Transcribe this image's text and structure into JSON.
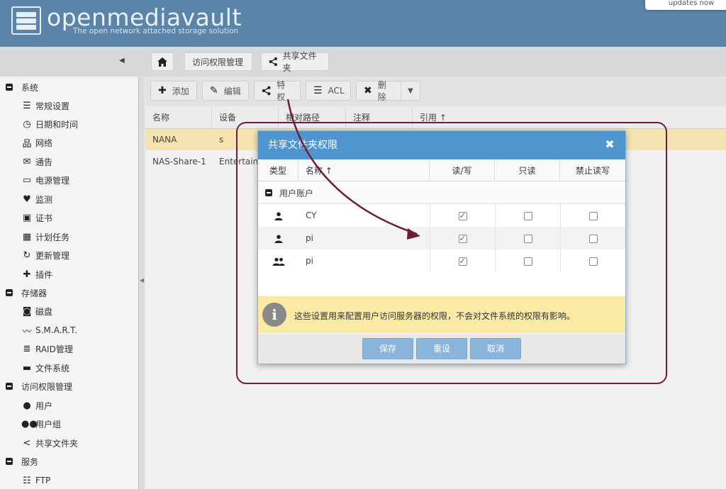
{
  "header": {
    "brand": "openmediavault",
    "tagline": "The open network attached storage solution",
    "updates_label": "updates now"
  },
  "breadcrumb": {
    "items": [
      "访问权限管理",
      "共享文件夹"
    ]
  },
  "sidebar": {
    "groups": [
      {
        "label": "系统",
        "items": [
          {
            "label": "常规设置",
            "icon": "sliders-icon"
          },
          {
            "label": "日期和时间",
            "icon": "clock-icon"
          },
          {
            "label": "网络",
            "icon": "network-icon"
          },
          {
            "label": "通告",
            "icon": "envelope-icon"
          },
          {
            "label": "电源管理",
            "icon": "battery-icon"
          },
          {
            "label": "监测",
            "icon": "heartbeat-icon"
          },
          {
            "label": "证书",
            "icon": "certificate-icon"
          },
          {
            "label": "计划任务",
            "icon": "calendar-icon"
          },
          {
            "label": "更新管理",
            "icon": "refresh-icon"
          },
          {
            "label": "插件",
            "icon": "puzzle-icon"
          }
        ]
      },
      {
        "label": "存储器",
        "items": [
          {
            "label": "磁盘",
            "icon": "disk-icon"
          },
          {
            "label": "S.M.A.R.T.",
            "icon": "pulse-icon"
          },
          {
            "label": "RAID管理",
            "icon": "database-icon"
          },
          {
            "label": "文件系统",
            "icon": "folder-icon"
          }
        ]
      },
      {
        "label": "访问权限管理",
        "items": [
          {
            "label": "用户",
            "icon": "user-icon"
          },
          {
            "label": "用户组",
            "icon": "users-icon"
          },
          {
            "label": "共享文件夹",
            "icon": "share-icon"
          }
        ]
      },
      {
        "label": "服务",
        "items": [
          {
            "label": "FTP",
            "icon": "server-icon"
          }
        ]
      }
    ]
  },
  "toolbar": {
    "add": "添加",
    "edit": "编辑",
    "privileges": "特权",
    "acl": "ACL",
    "delete": "删除"
  },
  "grid": {
    "columns": [
      "名称",
      "设备",
      "相对路径",
      "注释",
      "引用 ↑"
    ],
    "rows": [
      {
        "name": "NANA",
        "device": "s"
      },
      {
        "name": "NAS-Share-1",
        "device": "Entertainment"
      }
    ]
  },
  "dialog": {
    "title": "共享文件夹权限",
    "columns": [
      "类型",
      "名称 ↑",
      "读/写",
      "只读",
      "禁止读写"
    ],
    "group_label": "用户账户",
    "rows": [
      {
        "type_icon": "user-icon",
        "name": "CY",
        "read_write": true,
        "read_only": false,
        "no_access": false
      },
      {
        "type_icon": "user-icon",
        "name": "pi",
        "read_write": true,
        "read_only": false,
        "no_access": false
      },
      {
        "type_icon": "users-icon",
        "name": "pi",
        "read_write": true,
        "read_only": false,
        "no_access": false
      }
    ],
    "info_text": "这些设置用来配置用户访问服务器的权限，不会对文件系统的权限有影响。",
    "buttons": {
      "save": "保存",
      "reset": "重设",
      "cancel": "取消"
    }
  },
  "colors": {
    "header": "#5b85a8",
    "dialog_title": "#4f95cf",
    "selected_row": "#f6e4b0",
    "info_bg": "#fbeaa6",
    "annotation": "#6e1d3b"
  }
}
